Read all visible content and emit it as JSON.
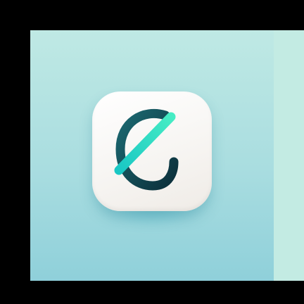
{
  "scene": {
    "colors": {
      "background": "#000000",
      "panel_top": "#bfe9e4",
      "panel_bottom": "#8fd0da",
      "tile": "#f6f4f1",
      "glyph_dark": "#0f3f4a",
      "glyph_accent": "#22d3c0"
    },
    "icon_name": "letter-g-plus-slash-icon"
  }
}
